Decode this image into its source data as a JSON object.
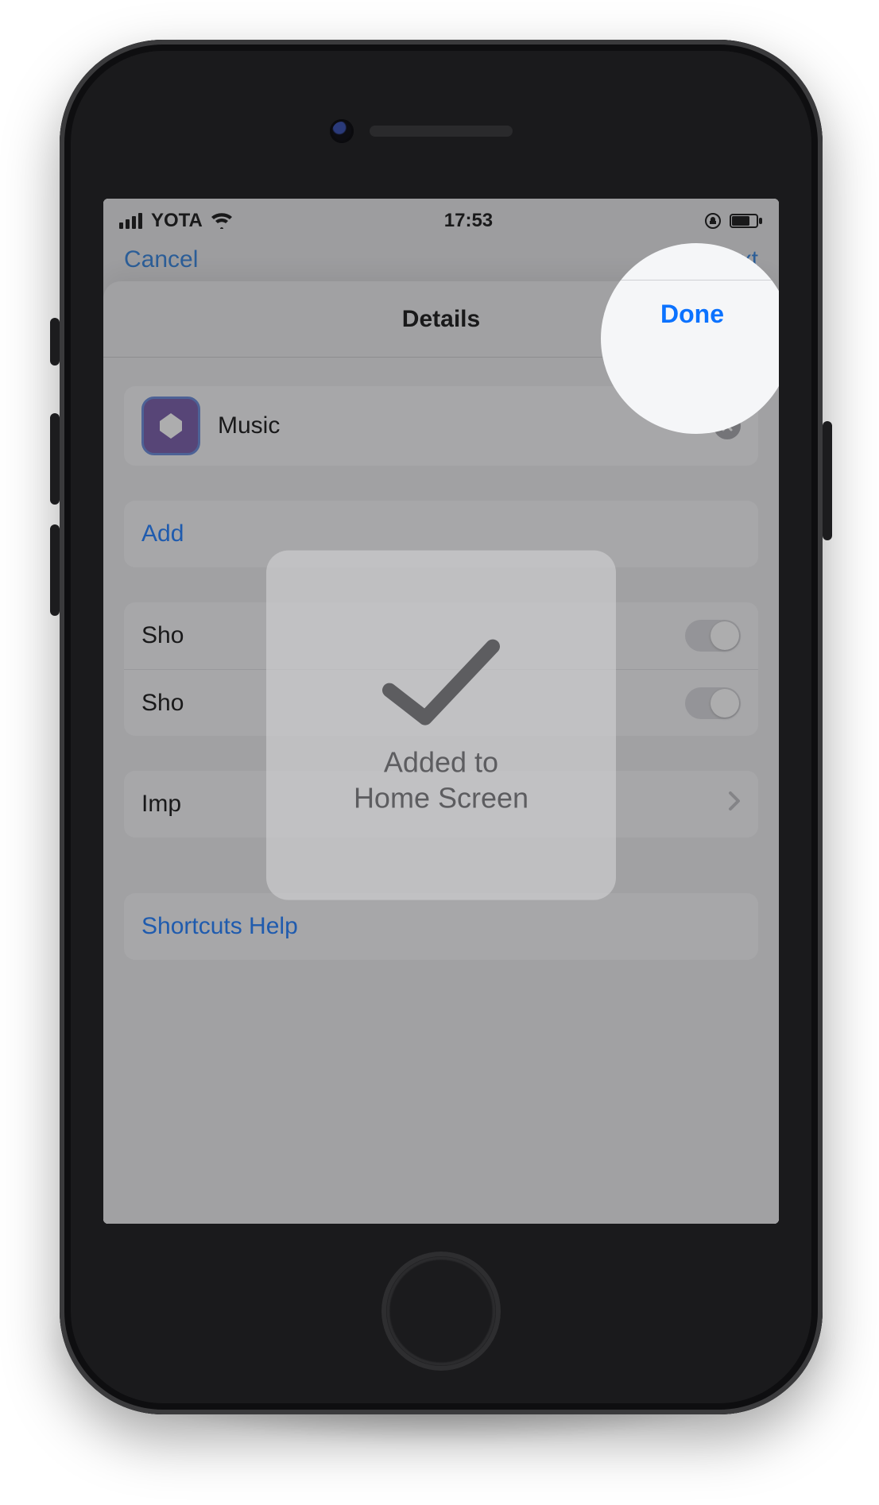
{
  "status": {
    "carrier": "YOTA",
    "time": "17:53"
  },
  "bg_nav": {
    "left": "Cancel",
    "right": "Next"
  },
  "sheet": {
    "title": "Details",
    "done": "Done",
    "shortcut_name": "Music",
    "rows": {
      "add": "Add",
      "show1": "Sho",
      "show2": "Sho",
      "import": "Imp",
      "help": "Shortcuts Help"
    }
  },
  "toast": {
    "line1": "Added to",
    "line2": "Home Screen"
  },
  "colors": {
    "ios_blue": "#0b72ff",
    "shortcut_purple": "#6b4ca1"
  }
}
